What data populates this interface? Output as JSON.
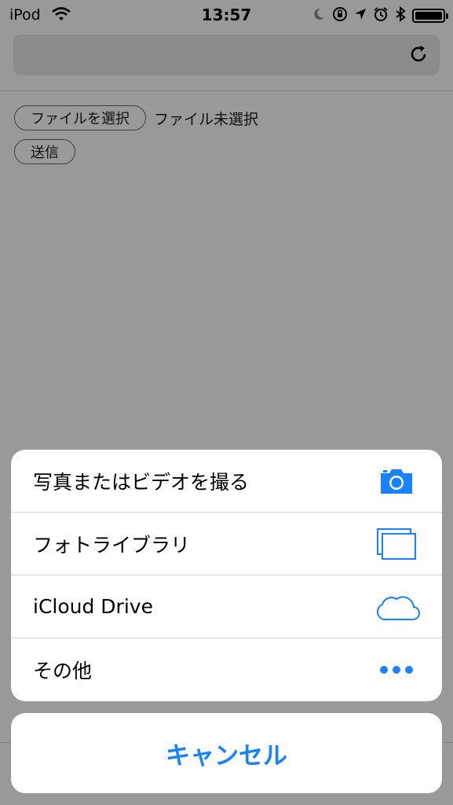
{
  "status_bar": {
    "carrier": "iPod",
    "time": "13:57"
  },
  "web": {
    "choose_file_label": "ファイルを選択",
    "file_status": "ファイル未選択",
    "send_label": "送信"
  },
  "action_sheet": {
    "items": [
      {
        "label": "写真またはビデオを撮る",
        "icon": "camera-icon"
      },
      {
        "label": "フォトライブラリ",
        "icon": "photo-library-icon"
      },
      {
        "label": "iCloud Drive",
        "icon": "cloud-icon"
      },
      {
        "label": "その他",
        "icon": "more-icon"
      }
    ],
    "cancel_label": "キャンセル"
  },
  "colors": {
    "accent": "#1a82fb",
    "dim_background": "#999999"
  }
}
